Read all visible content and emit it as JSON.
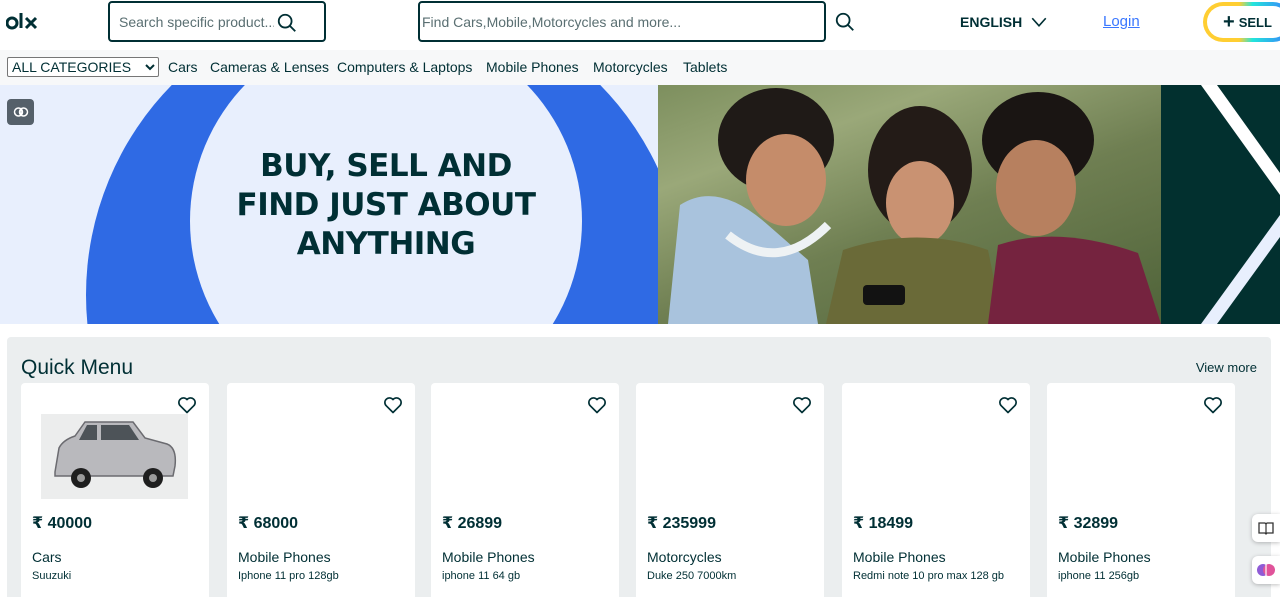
{
  "header": {
    "logo_text": "olx",
    "search_small": {
      "placeholder": "Search specific product..."
    },
    "search_main": {
      "placeholder": "Find Cars,Mobile,Motorcycles and more..."
    },
    "language": "ENGLISH",
    "login_label": "Login",
    "sell_label": "SELL"
  },
  "categories": {
    "selected": "ALL CATEGORIES",
    "links": [
      "Cars",
      "Cameras & Lenses",
      "Computers & Laptops",
      "Mobile Phones",
      "Motorcycles",
      "Tablets"
    ]
  },
  "banner": {
    "line1": "BUY, SELL AND",
    "line2": "FIND JUST ABOUT",
    "line3": "ANYTHING"
  },
  "quick_menu": {
    "title": "Quick Menu",
    "view_more": "View more",
    "items": [
      {
        "price": "₹ 40000",
        "category": "Cars",
        "title": "Suuzuki",
        "has_image": true
      },
      {
        "price": "₹ 68000",
        "category": "Mobile Phones",
        "title": "Iphone 11 pro 128gb",
        "has_image": false
      },
      {
        "price": "₹ 26899",
        "category": "Mobile Phones",
        "title": "iphone 11 64 gb",
        "has_image": false
      },
      {
        "price": "₹ 235999",
        "category": "Motorcycles",
        "title": "Duke 250 7000km",
        "has_image": false
      },
      {
        "price": "₹ 18499",
        "category": "Mobile Phones",
        "title": "Redmi note 10 pro max 128 gb",
        "has_image": false
      },
      {
        "price": "₹ 32899",
        "category": "Mobile Phones",
        "title": "iphone 11 256gb",
        "has_image": false
      }
    ]
  },
  "colors": {
    "brand_dark": "#002f34",
    "link_blue": "#3a77ff",
    "banner_blue": "#2f6ae4",
    "banner_light": "#e8effd",
    "panel_bg": "#ebeeef"
  }
}
